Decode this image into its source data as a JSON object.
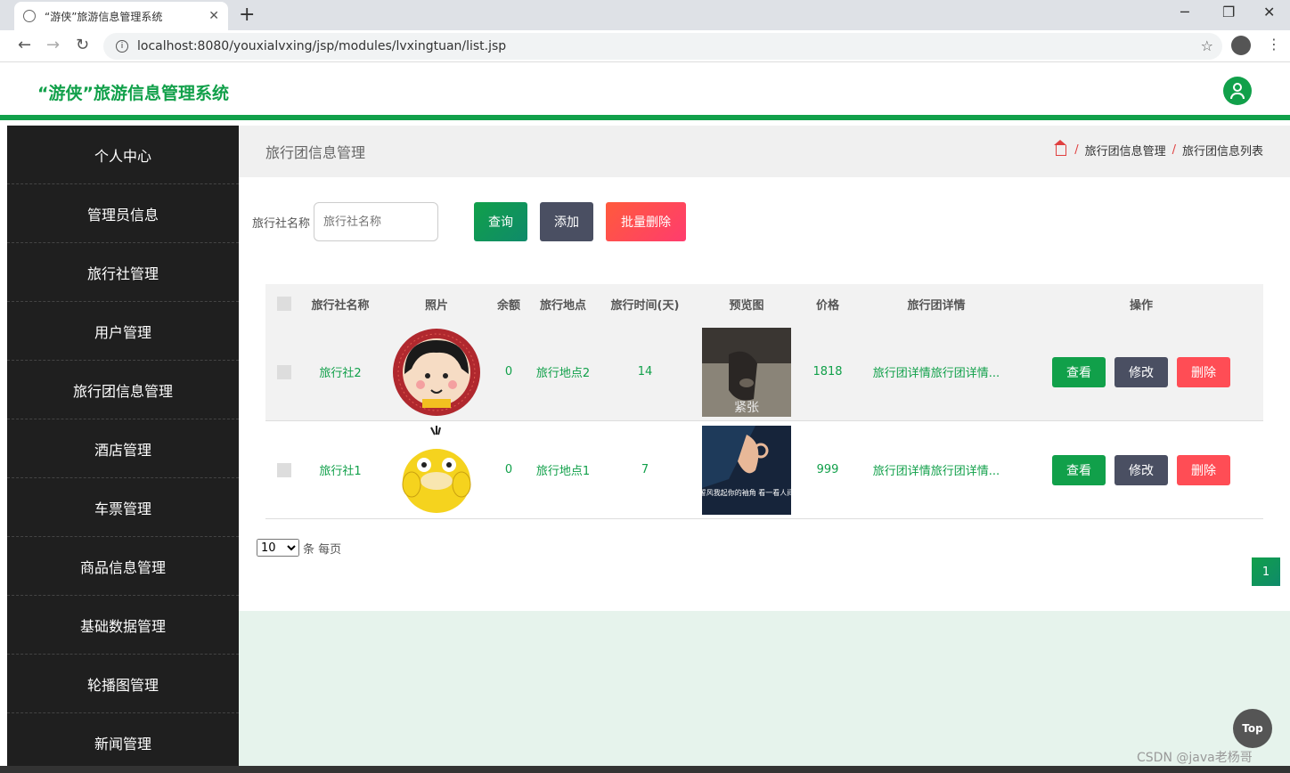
{
  "browser": {
    "tab_title": "“游侠”旅游信息管理系统",
    "tab_close": "✕",
    "new_tab": "+",
    "min": "─",
    "max": "❐",
    "close": "✕",
    "url": "localhost:8080/youxialvxing/jsp/modules/lvxingtuan/list.jsp"
  },
  "app": {
    "title": "“游侠”旅游信息管理系统",
    "accent": "#11a04a"
  },
  "sidebar": {
    "items": [
      {
        "label": "个人中心"
      },
      {
        "label": "管理员信息"
      },
      {
        "label": "旅行社管理"
      },
      {
        "label": "用户管理"
      },
      {
        "label": "旅行团信息管理"
      },
      {
        "label": "酒店管理"
      },
      {
        "label": "车票管理"
      },
      {
        "label": "商品信息管理"
      },
      {
        "label": "基础数据管理"
      },
      {
        "label": "轮播图管理"
      },
      {
        "label": "新闻管理"
      }
    ]
  },
  "page": {
    "title": "旅行团信息管理",
    "breadcrumb": [
      "旅行团信息管理",
      "旅行团信息列表"
    ]
  },
  "search": {
    "label": "旅行社名称",
    "placeholder": "旅行社名称",
    "query_label": "查询",
    "add_label": "添加",
    "batch_delete_label": "批量删除"
  },
  "table": {
    "headers": [
      "旅行社名称",
      "照片",
      "余额",
      "旅行地点",
      "旅行时间(天)",
      "预览图",
      "价格",
      "旅行团详情",
      "操作"
    ],
    "rows": [
      {
        "name": "旅行社2",
        "balance": "0",
        "location": "旅行地点2",
        "days": "14",
        "price": "1818",
        "detail": "旅行团详情旅行团详情...",
        "preview_text": "紧张"
      },
      {
        "name": "旅行社1",
        "balance": "0",
        "location": "旅行地点1",
        "days": "7",
        "price": "999",
        "detail": "旅行团详情旅行团详情...",
        "preview_text": "好想誓风我起你的袖角 看一看人间仙境"
      }
    ],
    "actions": {
      "view": "查看",
      "edit": "修改",
      "delete": "删除"
    }
  },
  "pager": {
    "page_size": "10",
    "suffix": "条 每页",
    "current_page": "1"
  },
  "top_button": "Top",
  "watermark": "CSDN @java老杨哥"
}
